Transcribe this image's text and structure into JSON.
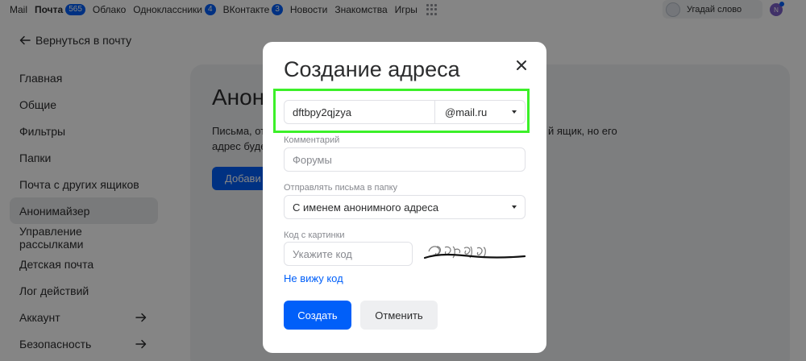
{
  "topbar": {
    "items": [
      {
        "label": "Mail"
      },
      {
        "label": "Почта",
        "badge": "565"
      },
      {
        "label": "Облако"
      },
      {
        "label": "Одноклассники",
        "badge": "4"
      },
      {
        "label": "ВКонтакте",
        "badge": "3"
      },
      {
        "label": "Новости"
      },
      {
        "label": "Знакомства"
      },
      {
        "label": "Игры"
      }
    ],
    "apps_icon": "apps-grid-icon",
    "guess_word": "Угадай слово",
    "avatar_initial": "N"
  },
  "sidebar": {
    "back_label": "Вернуться в почту",
    "items": [
      {
        "label": "Главная"
      },
      {
        "label": "Общие"
      },
      {
        "label": "Фильтры"
      },
      {
        "label": "Папки"
      },
      {
        "label": "Почта с других ящиков"
      },
      {
        "label": "Анонимайзер",
        "active": true
      },
      {
        "label": "Управление рассылками"
      },
      {
        "label": "Детская почта"
      },
      {
        "label": "Лог действий"
      },
      {
        "label": "Аккаунт",
        "arrow": true
      },
      {
        "label": "Безопасность",
        "arrow": true
      }
    ]
  },
  "panel": {
    "title": "Анон",
    "text_line1_start": "Письма, от",
    "text_line1_end": "й ящик, но его",
    "text_line2": "адрес буде",
    "button_label": "Добави"
  },
  "modal": {
    "title": "Создание адреса",
    "address_value": "dftbpy2qjzya",
    "domain_value": "@mail.ru",
    "comment_label": "Комментарий",
    "comment_placeholder": "Форумы",
    "folder_label": "Отправлять письма в папку",
    "folder_value": "С именем анонимного адреса",
    "captcha_label": "Код с картинки",
    "captcha_placeholder": "Укажите код",
    "no_code_link": "Не вижу код",
    "create_button": "Создать",
    "cancel_button": "Отменить"
  },
  "colors": {
    "accent": "#005ff9",
    "highlight": "#3cf029",
    "overlay": "rgba(0,0,0,0.48)"
  }
}
